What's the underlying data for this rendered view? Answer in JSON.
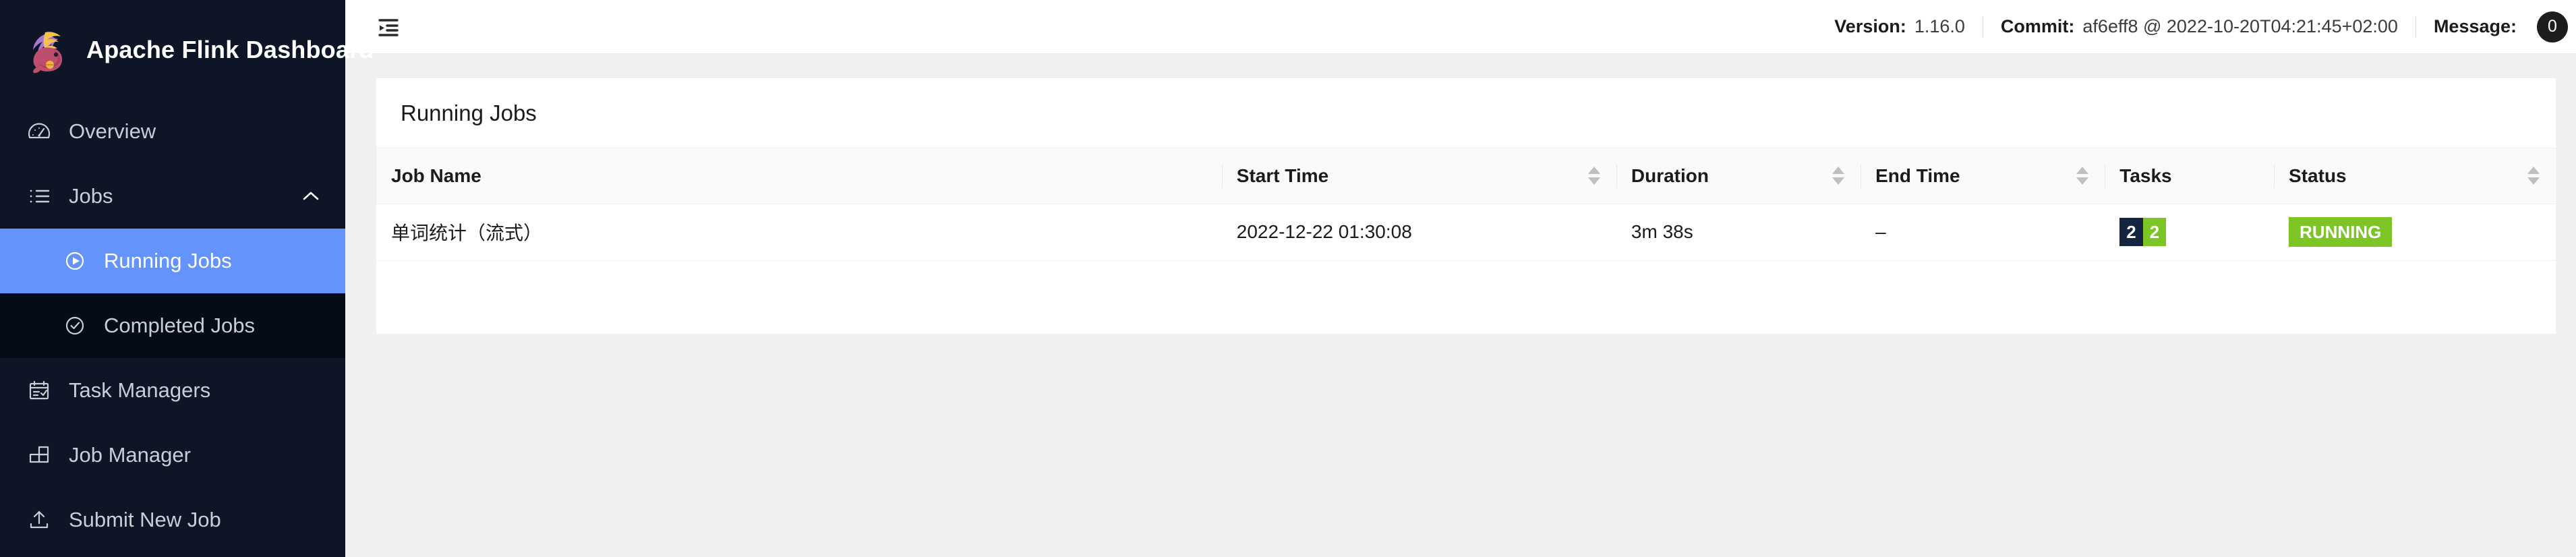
{
  "brand": {
    "title": "Apache Flink Dashboard",
    "logo_icon": "flink-squirrel-logo"
  },
  "sidebar": {
    "items": [
      {
        "label": "Overview",
        "icon": "dashboard-gauge-icon",
        "active": false
      },
      {
        "label": "Jobs",
        "icon": "ordered-list-icon",
        "active": false,
        "expanded": true,
        "arrow_icon": "chevron-up-icon"
      },
      {
        "label": "Task Managers",
        "icon": "schedule-calendar-icon",
        "active": false
      },
      {
        "label": "Job Manager",
        "icon": "blocks-layout-icon",
        "active": false
      },
      {
        "label": "Submit New Job",
        "icon": "upload-icon",
        "active": false
      }
    ],
    "submenu": [
      {
        "label": "Running Jobs",
        "icon": "play-circle-icon",
        "active": true
      },
      {
        "label": "Completed Jobs",
        "icon": "check-circle-icon",
        "active": false
      }
    ]
  },
  "topbar": {
    "fold_icon": "menu-fold-icon",
    "version_label": "Version:",
    "version_value": "1.16.0",
    "commit_label": "Commit:",
    "commit_value": "af6eff8 @ 2022-10-20T04:21:45+02:00",
    "message_label": "Message:",
    "message_count": "0"
  },
  "card": {
    "title": "Running Jobs"
  },
  "table": {
    "columns": [
      {
        "label": "Job Name",
        "sortable": false
      },
      {
        "label": "Start Time",
        "sortable": true
      },
      {
        "label": "Duration",
        "sortable": true
      },
      {
        "label": "End Time",
        "sortable": true
      },
      {
        "label": "Tasks",
        "sortable": false
      },
      {
        "label": "Status",
        "sortable": true
      }
    ],
    "rows": [
      {
        "job_name": "单词统计（流式）",
        "start_time": "2022-12-22 01:30:08",
        "duration": "3m 38s",
        "end_time": "–",
        "tasks": [
          {
            "value": "2",
            "color": "#16253f"
          },
          {
            "value": "2",
            "color": "#7dc425"
          }
        ],
        "status": "RUNNING",
        "status_color": "#7dc425"
      }
    ]
  },
  "colors": {
    "sidebar_bg": "#0d1526",
    "submenu_bg": "#060c17",
    "active_blue": "#6393fb",
    "status_green": "#7dc425",
    "task_navy": "#16253f",
    "content_bg": "#f0f0f0"
  }
}
